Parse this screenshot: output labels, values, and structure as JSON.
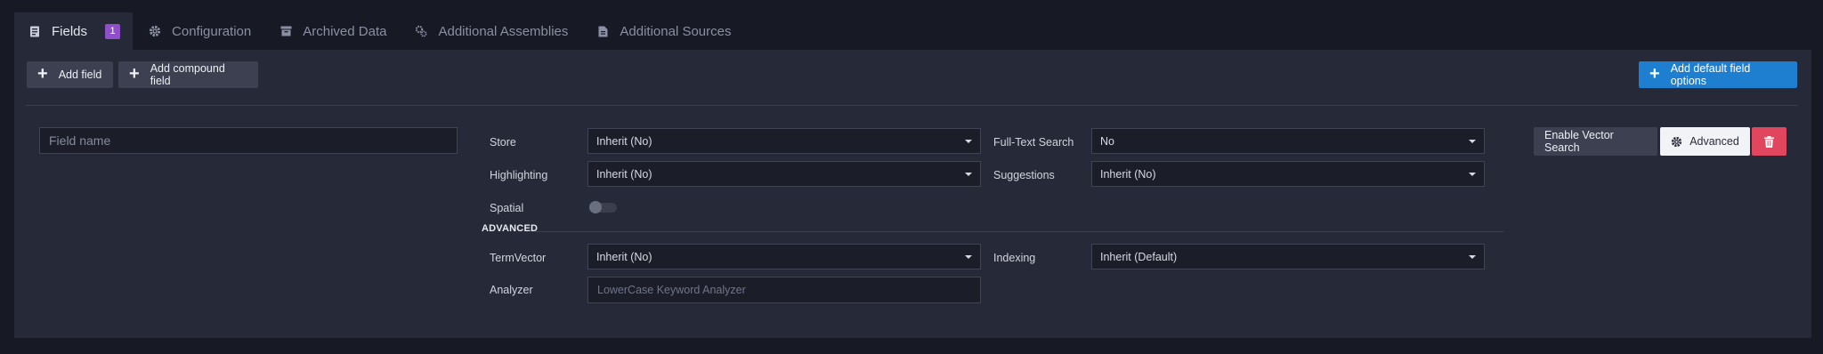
{
  "tabs": [
    {
      "label": "Fields",
      "icon": "fields-icon",
      "badge": "1",
      "active": true
    },
    {
      "label": "Configuration",
      "icon": "gear-icon"
    },
    {
      "label": "Archived Data",
      "icon": "archive-icon"
    },
    {
      "label": "Additional Assemblies",
      "icon": "assemblies-icon"
    },
    {
      "label": "Additional Sources",
      "icon": "file-icon"
    }
  ],
  "toolbar": {
    "add_field": "Add field",
    "add_compound_field": "Add compound field",
    "add_default_field_options": "Add default field options"
  },
  "field": {
    "name_placeholder": "Field name",
    "store_label": "Store",
    "store_value": "Inherit (No)",
    "fulltext_label": "Full-Text Search",
    "fulltext_value": "No",
    "highlighting_label": "Highlighting",
    "highlighting_value": "Inherit (No)",
    "suggestions_label": "Suggestions",
    "suggestions_value": "Inherit (No)",
    "spatial_label": "Spatial",
    "spatial_enabled": false,
    "advanced_header": "ADVANCED",
    "termvector_label": "TermVector",
    "termvector_value": "Inherit (No)",
    "indexing_label": "Indexing",
    "indexing_value": "Inherit (Default)",
    "analyzer_label": "Analyzer",
    "analyzer_placeholder": "LowerCase Keyword Analyzer"
  },
  "actions": {
    "enable_vector_search": "Enable Vector Search",
    "advanced": "Advanced",
    "delete_icon": "trash-icon"
  },
  "colors": {
    "background": "#171924",
    "panel": "#262a38",
    "accent_blue": "#1e7ed0",
    "danger": "#e0475f",
    "badge": "#8e4fc9"
  }
}
